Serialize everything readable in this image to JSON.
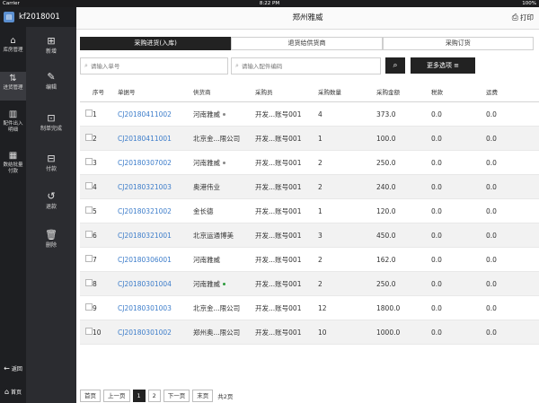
{
  "status_bar": {
    "carrier": "Carrier",
    "time": "8:22 PM",
    "battery": "100%"
  },
  "user": {
    "id": "kf2018001"
  },
  "nav": [
    {
      "label": "库房管理",
      "icon": "warehouse-icon"
    },
    {
      "label": "进货管理",
      "icon": "purchase-icon"
    },
    {
      "label": "配件出入明细",
      "icon": "parts-detail-icon"
    },
    {
      "label": "数结批量付款",
      "icon": "batch-pay-icon"
    }
  ],
  "tools": [
    {
      "label": "新增",
      "icon": "add-icon"
    },
    {
      "label": "编辑",
      "icon": "edit-icon"
    },
    {
      "label": "制单完成",
      "icon": "complete-icon"
    },
    {
      "label": "付款",
      "icon": "pay-icon"
    },
    {
      "label": "退款",
      "icon": "refund-icon"
    },
    {
      "label": "删除",
      "icon": "delete-icon"
    }
  ],
  "bottom_nav": {
    "back": "返回",
    "home": "首页"
  },
  "header": {
    "title": "郑州雅威",
    "print_label": "打印"
  },
  "tabs": [
    "采购进货(入库)",
    "退货给供货商",
    "采购订货"
  ],
  "search": {
    "doc_placeholder": "请输入单号",
    "part_placeholder": "请输入配件编码",
    "more_label": "更多选项 ≡"
  },
  "table": {
    "headers": [
      "序号",
      "单据号",
      "供货商",
      "采购员",
      "采购数量",
      "采购金额",
      "税款",
      "运费"
    ],
    "rows": [
      {
        "no": "1",
        "code": "CJ20180411002",
        "supplier": "河南雅威",
        "buyer": "开发...账号001",
        "qty": "4",
        "amount": "373.0",
        "tax": "0.0",
        "ship": "0.0"
      },
      {
        "no": "2",
        "code": "CJ20180411001",
        "supplier": "北京金...限公司",
        "buyer": "开发...账号001",
        "qty": "1",
        "amount": "100.0",
        "tax": "0.0",
        "ship": "0.0"
      },
      {
        "no": "3",
        "code": "CJ20180307002",
        "supplier": "河南雅威",
        "buyer": "开发...账号001",
        "qty": "2",
        "amount": "250.0",
        "tax": "0.0",
        "ship": "0.0"
      },
      {
        "no": "4",
        "code": "CJ20180321003",
        "supplier": "奥港伟业",
        "buyer": "开发...账号001",
        "qty": "2",
        "amount": "240.0",
        "tax": "0.0",
        "ship": "0.0"
      },
      {
        "no": "5",
        "code": "CJ20180321002",
        "supplier": "金长德",
        "buyer": "开发...账号001",
        "qty": "1",
        "amount": "120.0",
        "tax": "0.0",
        "ship": "0.0"
      },
      {
        "no": "6",
        "code": "CJ20180321001",
        "supplier": "北京运通博美",
        "buyer": "开发...账号001",
        "qty": "3",
        "amount": "450.0",
        "tax": "0.0",
        "ship": "0.0"
      },
      {
        "no": "7",
        "code": "CJ20180306001",
        "supplier": "河南雅威",
        "buyer": "开发...账号001",
        "qty": "2",
        "amount": "162.0",
        "tax": "0.0",
        "ship": "0.0"
      },
      {
        "no": "8",
        "code": "CJ20180301004",
        "supplier": "河南雅威",
        "buyer": "开发...账号001",
        "qty": "2",
        "amount": "250.0",
        "tax": "0.0",
        "ship": "0.0"
      },
      {
        "no": "9",
        "code": "CJ20180301003",
        "supplier": "北京金...限公司",
        "buyer": "开发...账号001",
        "qty": "12",
        "amount": "1800.0",
        "tax": "0.0",
        "ship": "0.0"
      },
      {
        "no": "10",
        "code": "CJ20180301002",
        "supplier": "郑州奥...限公司",
        "buyer": "开发...账号001",
        "qty": "10",
        "amount": "1000.0",
        "tax": "0.0",
        "ship": "0.0"
      }
    ]
  },
  "pager": {
    "first": "首页",
    "prev": "上一页",
    "pages": [
      "1",
      "2"
    ],
    "next": "下一页",
    "last": "末页",
    "total": "共2页"
  }
}
